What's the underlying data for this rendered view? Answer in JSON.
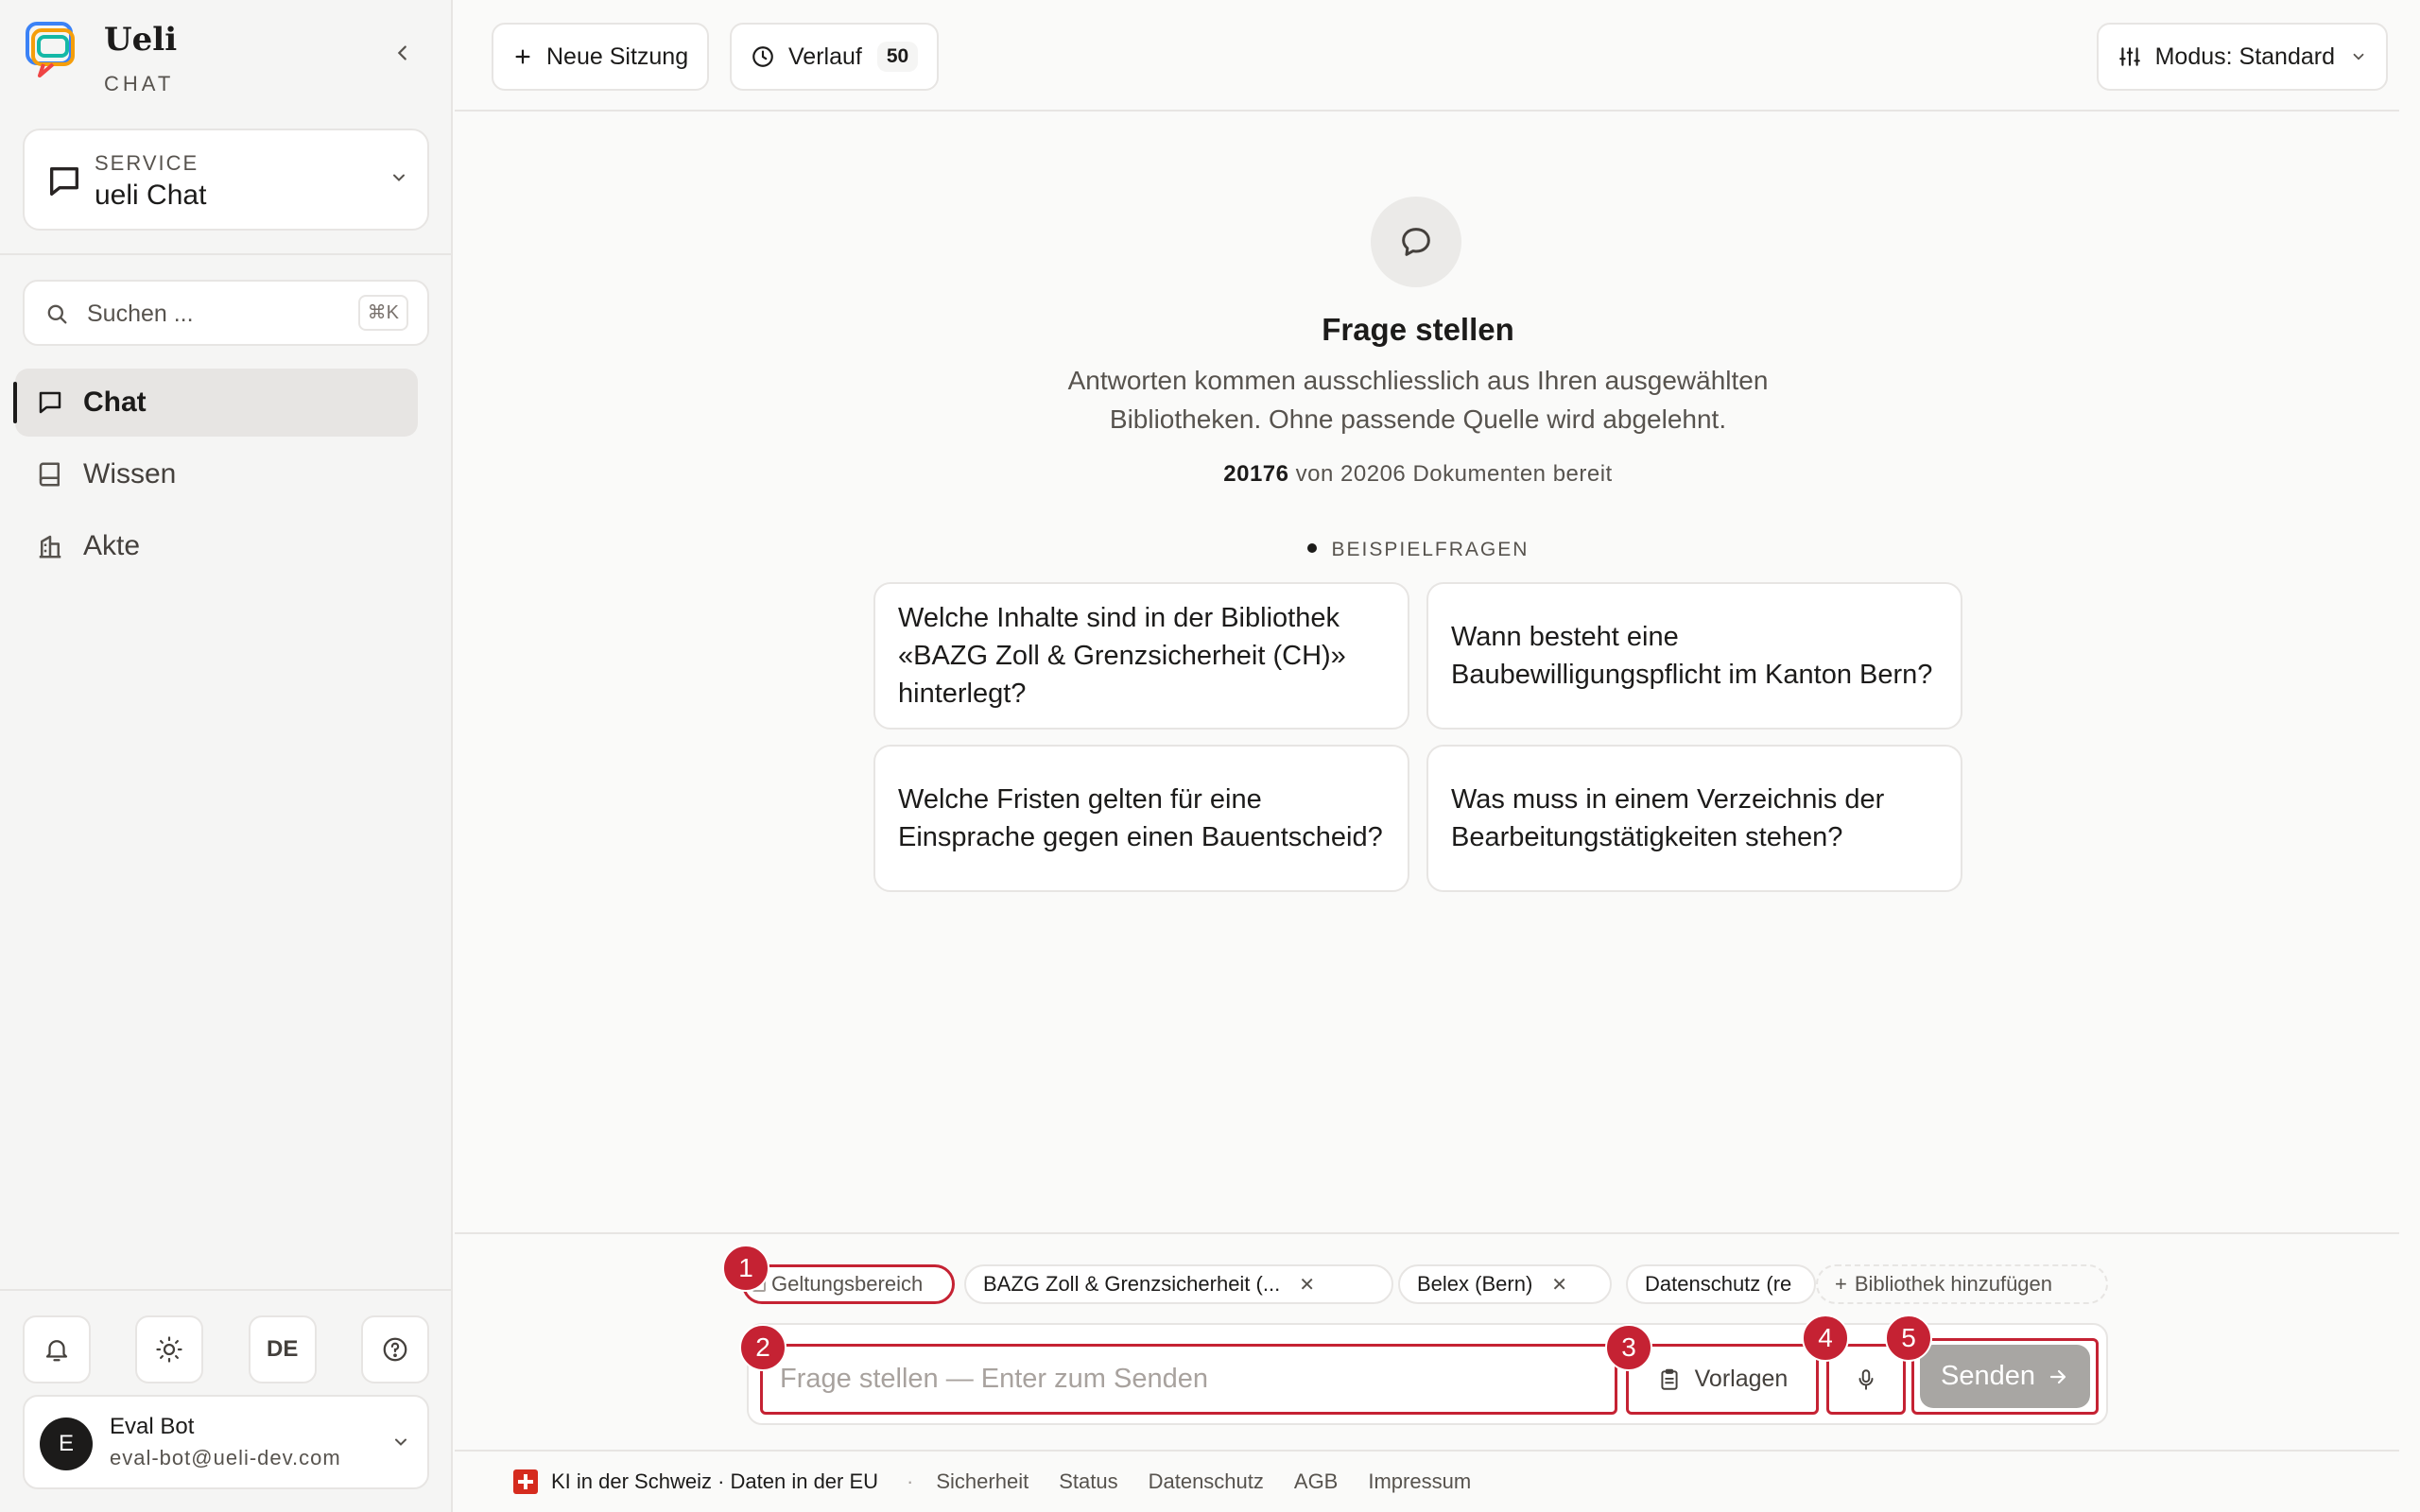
{
  "brand": {
    "name": "Ueli",
    "subtitle": "CHAT"
  },
  "service": {
    "label": "SERVICE",
    "value": "ueli Chat"
  },
  "search": {
    "placeholder": "Suchen ...",
    "shortcut": "⌘K"
  },
  "nav": [
    {
      "label": "Chat",
      "icon": "chat-bubble-icon",
      "active": true
    },
    {
      "label": "Wissen",
      "icon": "book-icon",
      "active": false
    },
    {
      "label": "Akte",
      "icon": "building-icon",
      "active": false
    }
  ],
  "tools": {
    "language": "DE"
  },
  "user": {
    "avatar": "E",
    "name": "Eval Bot",
    "email": "eval-bot@ueli-dev.com"
  },
  "header": {
    "new_session": "Neue Sitzung",
    "history": "Verlauf",
    "history_count": "50",
    "mode": "Modus: Standard"
  },
  "empty_state": {
    "title": "Frage stellen",
    "description": "Antworten kommen ausschliesslich aus Ihren ausgewählten Bibliotheken. Ohne passende Quelle wird abgelehnt.",
    "ready_count": "20176",
    "ready_suffix": "von 20206 Dokumenten bereit"
  },
  "examples": {
    "label": "BEISPIELFRAGEN",
    "items": [
      "Welche Inhalte sind in der Bibliothek «BAZG Zoll & Grenzsicherheit (CH)» hinterlegt?",
      "Wann besteht eine Baubewilligungspflicht im Kanton Bern?",
      "Welche Fristen gelten für eine Einsprache gegen einen Bauentscheid?",
      "Was muss in einem Verzeichnis der Bearbeitungstätigkeiten stehen?"
    ]
  },
  "composer": {
    "scope_label": "Geltungsbereich",
    "libraries": [
      "BAZG Zoll & Grenzsicherheit (...",
      "Belex (Bern)",
      "Datenschutz (re"
    ],
    "add_library": "Bibliothek hinzufügen",
    "placeholder": "Frage stellen — Enter zum Senden",
    "templates": "Vorlagen",
    "send": "Senden",
    "markers": [
      "1",
      "2",
      "3",
      "4",
      "5"
    ]
  },
  "footer": {
    "location": "KI in der Schweiz · Daten in der EU",
    "links": [
      "Sicherheit",
      "Status",
      "Datenschutz",
      "AGB",
      "Impressum"
    ]
  },
  "colors": {
    "accent_marker": "#c52233",
    "send_disabled": "#a8a6a3",
    "swiss_red": "#d52b1e"
  }
}
